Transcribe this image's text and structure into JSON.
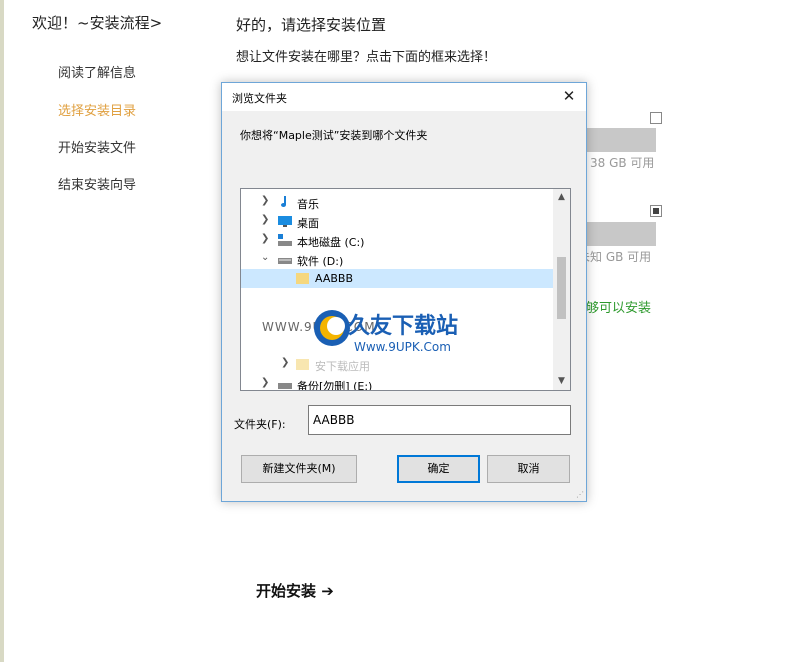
{
  "sidebar": {
    "header": "欢迎！~安装流程>",
    "items": [
      {
        "label": "阅读了解信息",
        "active": false
      },
      {
        "label": "选择安装目录",
        "active": true
      },
      {
        "label": "开始安装文件",
        "active": false
      },
      {
        "label": "结束安装向导",
        "active": false
      }
    ]
  },
  "main": {
    "title": "好的，请选择安装位置",
    "subtitle": "想让文件安装在哪里？点击下面的框来选择！",
    "drive_info_1": "38 GB 可用",
    "drive_info_2": "未知 GB 可用",
    "status_text": "够可以安装",
    "start_button": "开始安装 ➔"
  },
  "dialog": {
    "title": "浏览文件夹",
    "prompt": "你想将“Maple测试”安装到哪个文件夹",
    "tree": [
      {
        "label": "音乐",
        "icon": "music-icon",
        "expanded": false
      },
      {
        "label": "桌面",
        "icon": "desktop-icon",
        "expanded": false
      },
      {
        "label": "本地磁盘 (C:)",
        "icon": "drive-icon",
        "expanded": false
      },
      {
        "label": "软件 (D:)",
        "icon": "drive-icon",
        "expanded": true
      },
      {
        "label": "AABBB",
        "icon": "folder-icon",
        "selected": true
      },
      {
        "label": "安下载应用",
        "icon": "folder-icon"
      },
      {
        "label": "备份[勿删] (E:)",
        "icon": "drive-icon"
      }
    ],
    "folder_label": "文件夹(F):",
    "folder_value": "AABBB",
    "new_folder_button": "新建文件夹(M)",
    "ok_button": "确定",
    "cancel_button": "取消"
  },
  "watermark": {
    "small": "WWW.9UPK.COM",
    "title": "久友下载站",
    "url": "Www.9UPK.Com"
  },
  "colors": {
    "accent_active": "#e0a040",
    "status_green": "#2d9a2d",
    "dialog_border": "#6ea6d8",
    "primary_button_border": "#0078d7"
  }
}
